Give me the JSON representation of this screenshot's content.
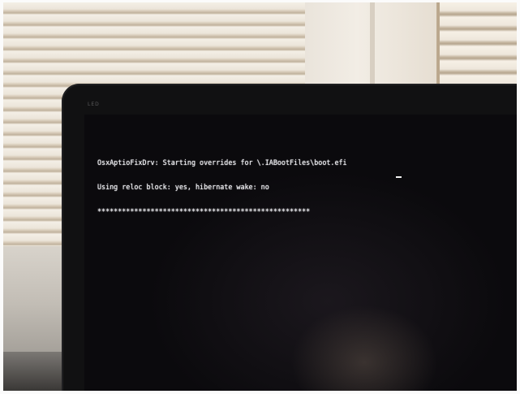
{
  "monitor": {
    "brand": "LED"
  },
  "terminal": {
    "lines": [
      "OsxAptioFixDrv: Starting overrides for \\.IABootFiles\\boot.efi",
      "Using reloc block: yes, hibernate wake: no",
      "****************************************************"
    ]
  }
}
